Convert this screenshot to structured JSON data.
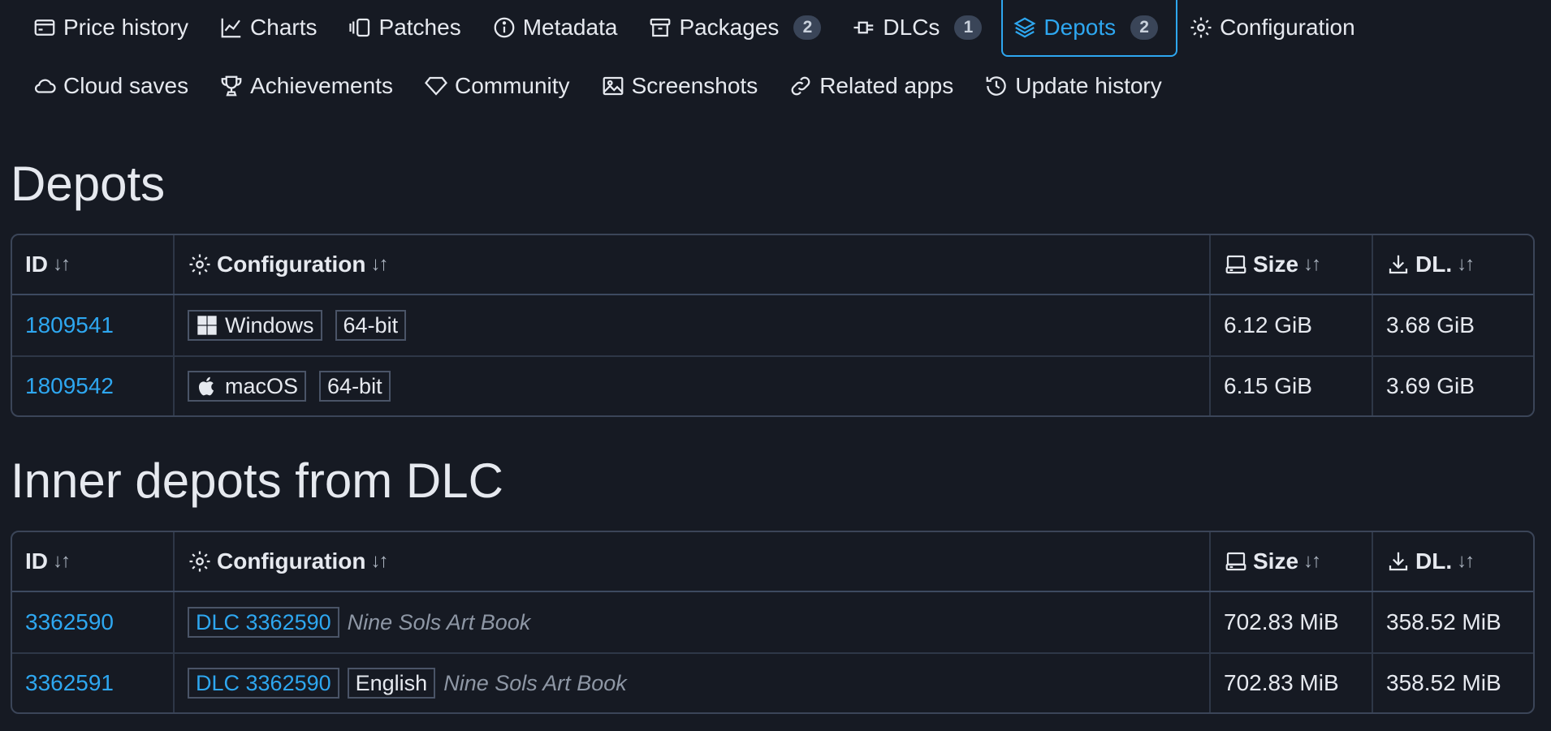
{
  "tabs_row1": [
    {
      "label": "Price history",
      "icon": "price-history-icon"
    },
    {
      "label": "Charts",
      "icon": "chart-icon"
    },
    {
      "label": "Patches",
      "icon": "patches-icon"
    },
    {
      "label": "Metadata",
      "icon": "info-icon"
    },
    {
      "label": "Packages",
      "icon": "package-icon",
      "badge": "2"
    },
    {
      "label": "DLCs",
      "icon": "plug-icon",
      "badge": "1"
    },
    {
      "label": "Depots",
      "icon": "layers-icon",
      "badge": "2",
      "active": true
    },
    {
      "label": "Configuration",
      "icon": "gear-icon"
    }
  ],
  "tabs_row2": [
    {
      "label": "Cloud saves",
      "icon": "cloud-icon"
    },
    {
      "label": "Achievements",
      "icon": "trophy-icon"
    },
    {
      "label": "Community",
      "icon": "diamond-icon"
    },
    {
      "label": "Screenshots",
      "icon": "image-icon"
    },
    {
      "label": "Related apps",
      "icon": "link-icon"
    },
    {
      "label": "Update history",
      "icon": "history-icon"
    }
  ],
  "colors": {
    "accent": "#2ea7f0",
    "background": "#161a23",
    "border": "#3b4558"
  },
  "depots": {
    "title": "Depots",
    "columns": {
      "id": "ID",
      "config": "Configuration",
      "size": "Size",
      "dl": "DL."
    },
    "rows": [
      {
        "id": "1809541",
        "os": "Windows",
        "os_icon": "windows-icon",
        "arch": "64-bit",
        "size": "6.12 GiB",
        "dl": "3.68 GiB"
      },
      {
        "id": "1809542",
        "os": "macOS",
        "os_icon": "apple-icon",
        "arch": "64-bit",
        "size": "6.15 GiB",
        "dl": "3.69 GiB"
      }
    ]
  },
  "inner": {
    "title": "Inner depots from DLC",
    "columns": {
      "id": "ID",
      "config": "Configuration",
      "size": "Size",
      "dl": "DL."
    },
    "rows": [
      {
        "id": "3362590",
        "dlc": "DLC 3362590",
        "lang": "",
        "name": "Nine Sols Art Book",
        "size": "702.83 MiB",
        "dl": "358.52 MiB"
      },
      {
        "id": "3362591",
        "dlc": "DLC 3362590",
        "lang": "English",
        "name": "Nine Sols Art Book",
        "size": "702.83 MiB",
        "dl": "358.52 MiB"
      }
    ]
  }
}
